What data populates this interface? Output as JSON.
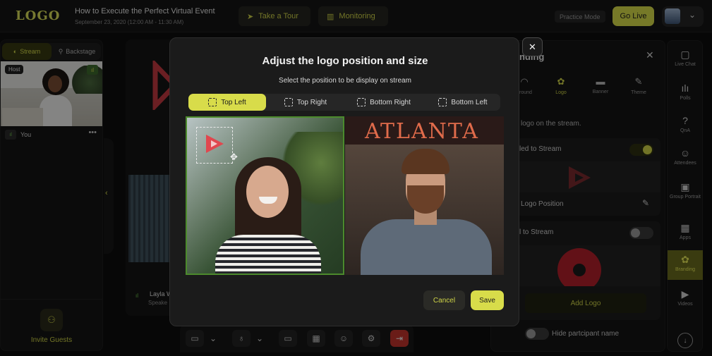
{
  "header": {
    "logo": "LOGO",
    "event_title": "How to Execute the Perfect Virtual Event",
    "event_date": "September 23, 2020 (12:00 AM - 11:30 AM)",
    "take_tour": "Take a Tour",
    "monitoring": "Monitoring",
    "practice_mode": "Practice Mode",
    "go_live": "Go Live"
  },
  "left_panel": {
    "tabs": {
      "stream": "Stream",
      "backstage": "Backstage"
    },
    "host_badge": "Host",
    "you_label": "You",
    "more": "•••",
    "invite_guests": "Invite Guests"
  },
  "stage": {
    "speaker_name": "Layla W",
    "speaker_role": "Speake"
  },
  "right_panel": {
    "title": "nding",
    "tabs": [
      "ground",
      "Logo",
      "Banner",
      "Theme"
    ],
    "active_tab": "Logo",
    "hint": "logo on the stream.",
    "card1_label": "led to Stream",
    "logo_position": "Logo Position",
    "card2_label": "l to Stream",
    "add_logo": "Add Logo",
    "hide_participant": "Hide partcipant name"
  },
  "sidebar": {
    "items": [
      "Live Chat",
      "Polls",
      "QnA",
      "Attendees",
      "Group Portrait",
      "Apps",
      "Branding",
      "Videos"
    ],
    "active": "Branding"
  },
  "modal": {
    "title": "Adjust the logo position and size",
    "subtitle": "Select the position to be display on stream",
    "positions": [
      "Top Left",
      "Top Right",
      "Bottom Right",
      "Bottom Left"
    ],
    "selected_position": "Top Left",
    "right_preview_sign": "ATLANTA",
    "cancel": "Cancel",
    "save": "Save"
  },
  "colors": {
    "accent": "#d8dc4a",
    "logo_red": "#e0474f",
    "selection_green": "#4c8a2c",
    "leave_red": "#c2342c"
  }
}
